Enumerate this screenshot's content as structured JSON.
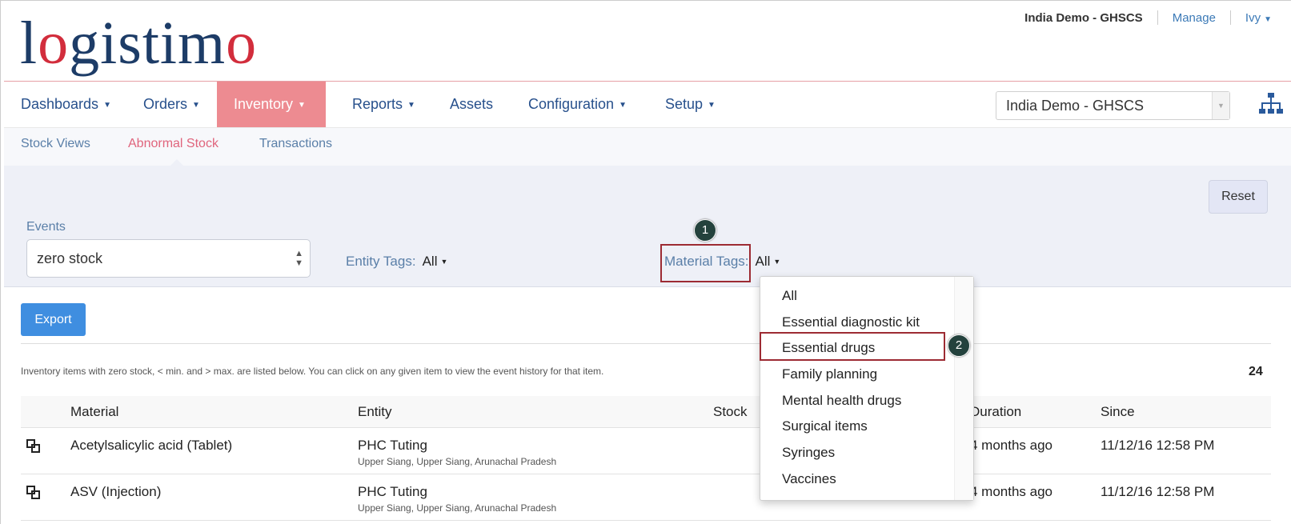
{
  "header": {
    "logo_text": "logistimo",
    "account": "India Demo - GHSCS",
    "manage": "Manage",
    "user": "Ivy"
  },
  "nav": {
    "items": [
      "Dashboards",
      "Orders",
      "Inventory",
      "Reports",
      "Assets",
      "Configuration",
      "Setup"
    ],
    "active": "Inventory",
    "domain_select": "India Demo - GHSCS",
    "hierarchy_icon": "hierarchy-icon"
  },
  "subnav": {
    "items": [
      "Stock Views",
      "Abnormal Stock",
      "Transactions"
    ],
    "active": "Abnormal Stock"
  },
  "filters": {
    "reset": "Reset",
    "events_label": "Events",
    "events_value": "zero stock",
    "entity_tags_label": "Entity Tags:",
    "entity_tags_value": "All",
    "material_tags_label": "Material Tags:",
    "material_tags_value": "All"
  },
  "material_tags_menu": {
    "options": [
      "All",
      "Essential diagnostic kit",
      "Essential drugs",
      "Family planning",
      "Mental health drugs",
      "Surgical items",
      "Syringes",
      "Vaccines"
    ],
    "highlighted": "Essential drugs"
  },
  "annotations": {
    "badge1": "1",
    "badge2": "2"
  },
  "content": {
    "export": "Export",
    "info": "Inventory items with zero stock, < min. and > max. are listed below. You can click on any given item to view the event history for that item.",
    "count": "24"
  },
  "table": {
    "headers": [
      "Material",
      "Entity",
      "Stock",
      "Duration",
      "Since"
    ],
    "rows": [
      {
        "material": "Acetylsalicylic acid (Tablet)",
        "entity": "PHC Tuting",
        "location": "Upper Siang, Upper Siang, Arunachal Pradesh",
        "duration": "4 months ago",
        "since": "11/12/16 12:58 PM"
      },
      {
        "material": "ASV (Injection)",
        "entity": "PHC Tuting",
        "location": "Upper Siang, Upper Siang, Arunachal Pradesh",
        "duration": "4 months ago",
        "since": "11/12/16 12:58 PM"
      }
    ]
  },
  "colors": {
    "brand_navy": "#1d3c67",
    "brand_red": "#d22d3c",
    "active_tab": "#ed8b91",
    "export_button": "#3f8ee0",
    "annotation_box": "#9d2b33",
    "annotation_badge": "#24423d"
  }
}
